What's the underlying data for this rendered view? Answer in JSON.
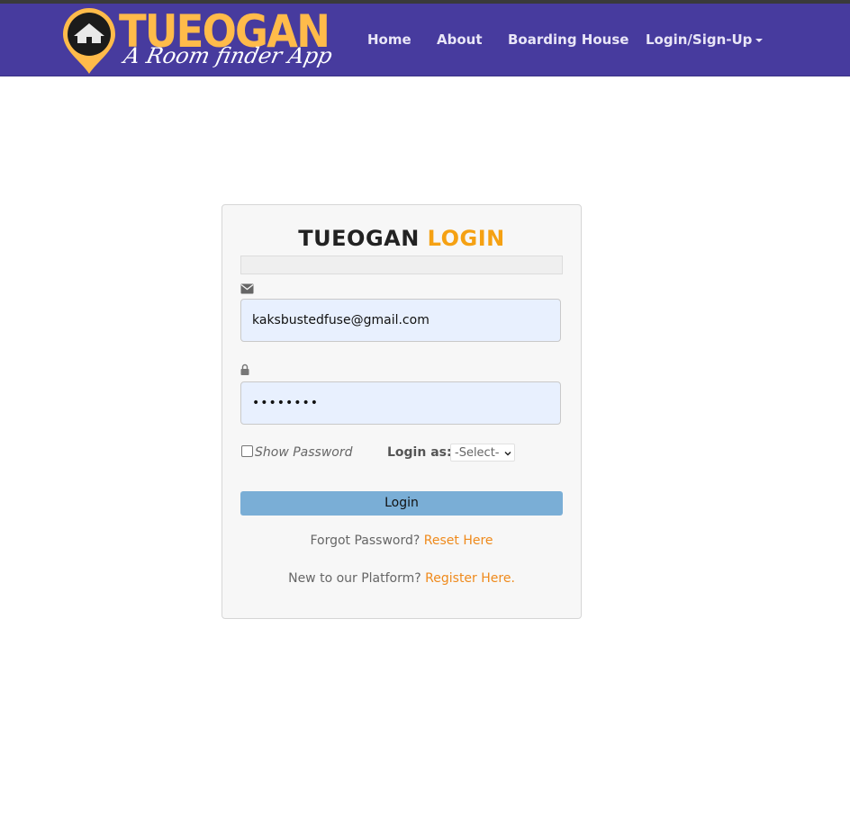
{
  "navbar": {
    "logo_word": "TUEOGAN",
    "logo_tagline": "A Room finder App",
    "logo_badge": "TUEOGAN",
    "items": [
      {
        "label": "Home"
      },
      {
        "label": "About"
      },
      {
        "label": "Boarding House"
      },
      {
        "label": "Login/Sign-Up"
      }
    ]
  },
  "login": {
    "title_part1": "TUEOGAN",
    "title_part2": "LOGIN",
    "email_value": "kaksbustedfuse@gmail.com",
    "password_value": "••••••••",
    "show_password_label": "Show Password",
    "login_as_label": "Login as:",
    "login_as_selected": "-Select-",
    "submit_label": "Login",
    "forgot_text": "Forgot Password?",
    "reset_link": "Reset Here",
    "new_text": "New to our Platform?",
    "register_link": "Register Here."
  },
  "icons": {
    "email": "envelope-icon",
    "password": "lock-icon",
    "dropdown": "caret-down-icon"
  },
  "colors": {
    "navbar": "#473b9e",
    "accent_orange": "#f5a113",
    "link_orange": "#ef8a1c",
    "button": "#7aaed6",
    "input_bg": "#e8f0fe"
  }
}
